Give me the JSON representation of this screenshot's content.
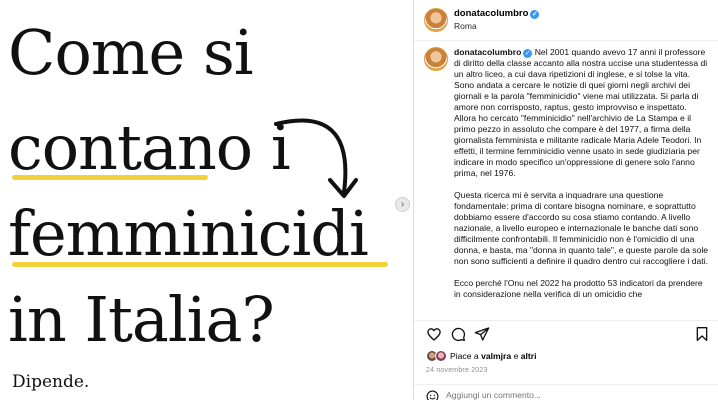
{
  "post_image": {
    "line1": "Come si",
    "line2": "contano i",
    "line3": "femminicidi",
    "line4": "in Italia?",
    "subline": "Dipende.",
    "next_button": "›",
    "accent_color": "#f1d23a"
  },
  "header": {
    "username": "donatacolumbro",
    "verified": "✓",
    "location": "Roma"
  },
  "caption": {
    "username": "donatacolumbro",
    "paragraphs": [
      "Nel 2001 quando avevo 17 anni il professore di diritto della classe accanto alla nostra uccise una studentessa di un altro liceo, a cui dava ripetizioni di inglese, e si tolse la vita. Sono andata a cercare le notizie di quei giorni negli archivi dei giornali e la parola \"femminicidio\" viene mai utilizzata. Si parla di amore non corrisposto, raptus, gesto improvviso e inspettato. Allora ho cercato \"femminicidio\" nell'archivio de La Stampa e il primo pezzo in assoluto che compare è del 1977, a firma della giornalista femminista e militante radicale Maria Adele Teodori. In effetti, il termine femminicidio venne usato in sede giudiziaria per indicare in modo specifico un'oppressione di genere solo l'anno prima, nel 1976.",
      "Questa ricerca mi è servita a inquadrare una questione fondamentale: prima di contare bisogna nominare, e soprattutto dobbiamo essere d'accordo su cosa stiamo contando. A livello nazionale, a livello europeo e internazionale le banche dati sono difficilmente confrontabili. Il femminicidio non è l'omicidio di una donna, e basta, ma \"donna in quanto tale\", e queste parole da sole non sono sufficienti a definire il quadro dentro cui raccogliere i dati.",
      "Ecco perché l'Onu nel 2022 ha prodotto 53 indicatori da prendere in considerazione nella verifica di un omicidio che"
    ]
  },
  "actions": {
    "like": "heart-icon",
    "comment": "comment-icon",
    "share": "share-icon",
    "save": "bookmark-icon"
  },
  "likes": {
    "prefix": "Piace a",
    "user": "valmjra",
    "connector": "e",
    "others": "altri"
  },
  "date": "24 novembre 2023",
  "comment_box": {
    "placeholder": "Aggiungi un commento..."
  }
}
